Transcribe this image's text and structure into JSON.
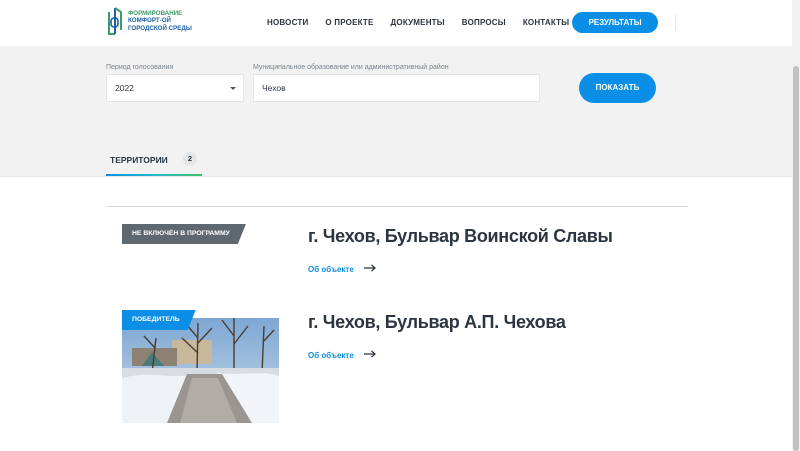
{
  "logo": {
    "line1": "ФОРМИРОВАНИЕ",
    "line2": "КОМФОРТ-ОЙ",
    "line3": "ГОРОДСКОЙ СРЕДЫ",
    "icon": "logo-icon"
  },
  "nav": {
    "items": [
      "НОВОСТИ",
      "О ПРОЕКТЕ",
      "ДОКУМЕНТЫ",
      "ВОПРОСЫ",
      "КОНТАКТЫ"
    ],
    "results_button": "РЕЗУЛЬТАТЫ"
  },
  "filter": {
    "period_label": "Период голосования",
    "period_value": "2022",
    "municipality_label": "Муниципальное образование или административный район",
    "municipality_value": "Чехов",
    "show_button": "ПОКАЗАТЬ"
  },
  "tabs": [
    {
      "label": "ТЕРРИТОРИИ",
      "count": "2",
      "active": true
    }
  ],
  "territories": [
    {
      "badge": "НЕ ВКЛЮЧЁН В ПРОГРАММУ",
      "badge_color": "#5f6770",
      "title": "г. Чехов, Бульвар Воинской Славы",
      "link": "Об объекте",
      "has_photo": false
    },
    {
      "badge": "ПОБЕДИТЕЛЬ",
      "badge_color": "#0b8fe6",
      "title": "г. Чехов, Бульвар А.П. Чехова",
      "link": "Об объекте",
      "has_photo": true
    }
  ],
  "colors": {
    "accent": "#0b8fe6",
    "text": "#2c3540",
    "filter_bg": "#f2f2f2"
  }
}
